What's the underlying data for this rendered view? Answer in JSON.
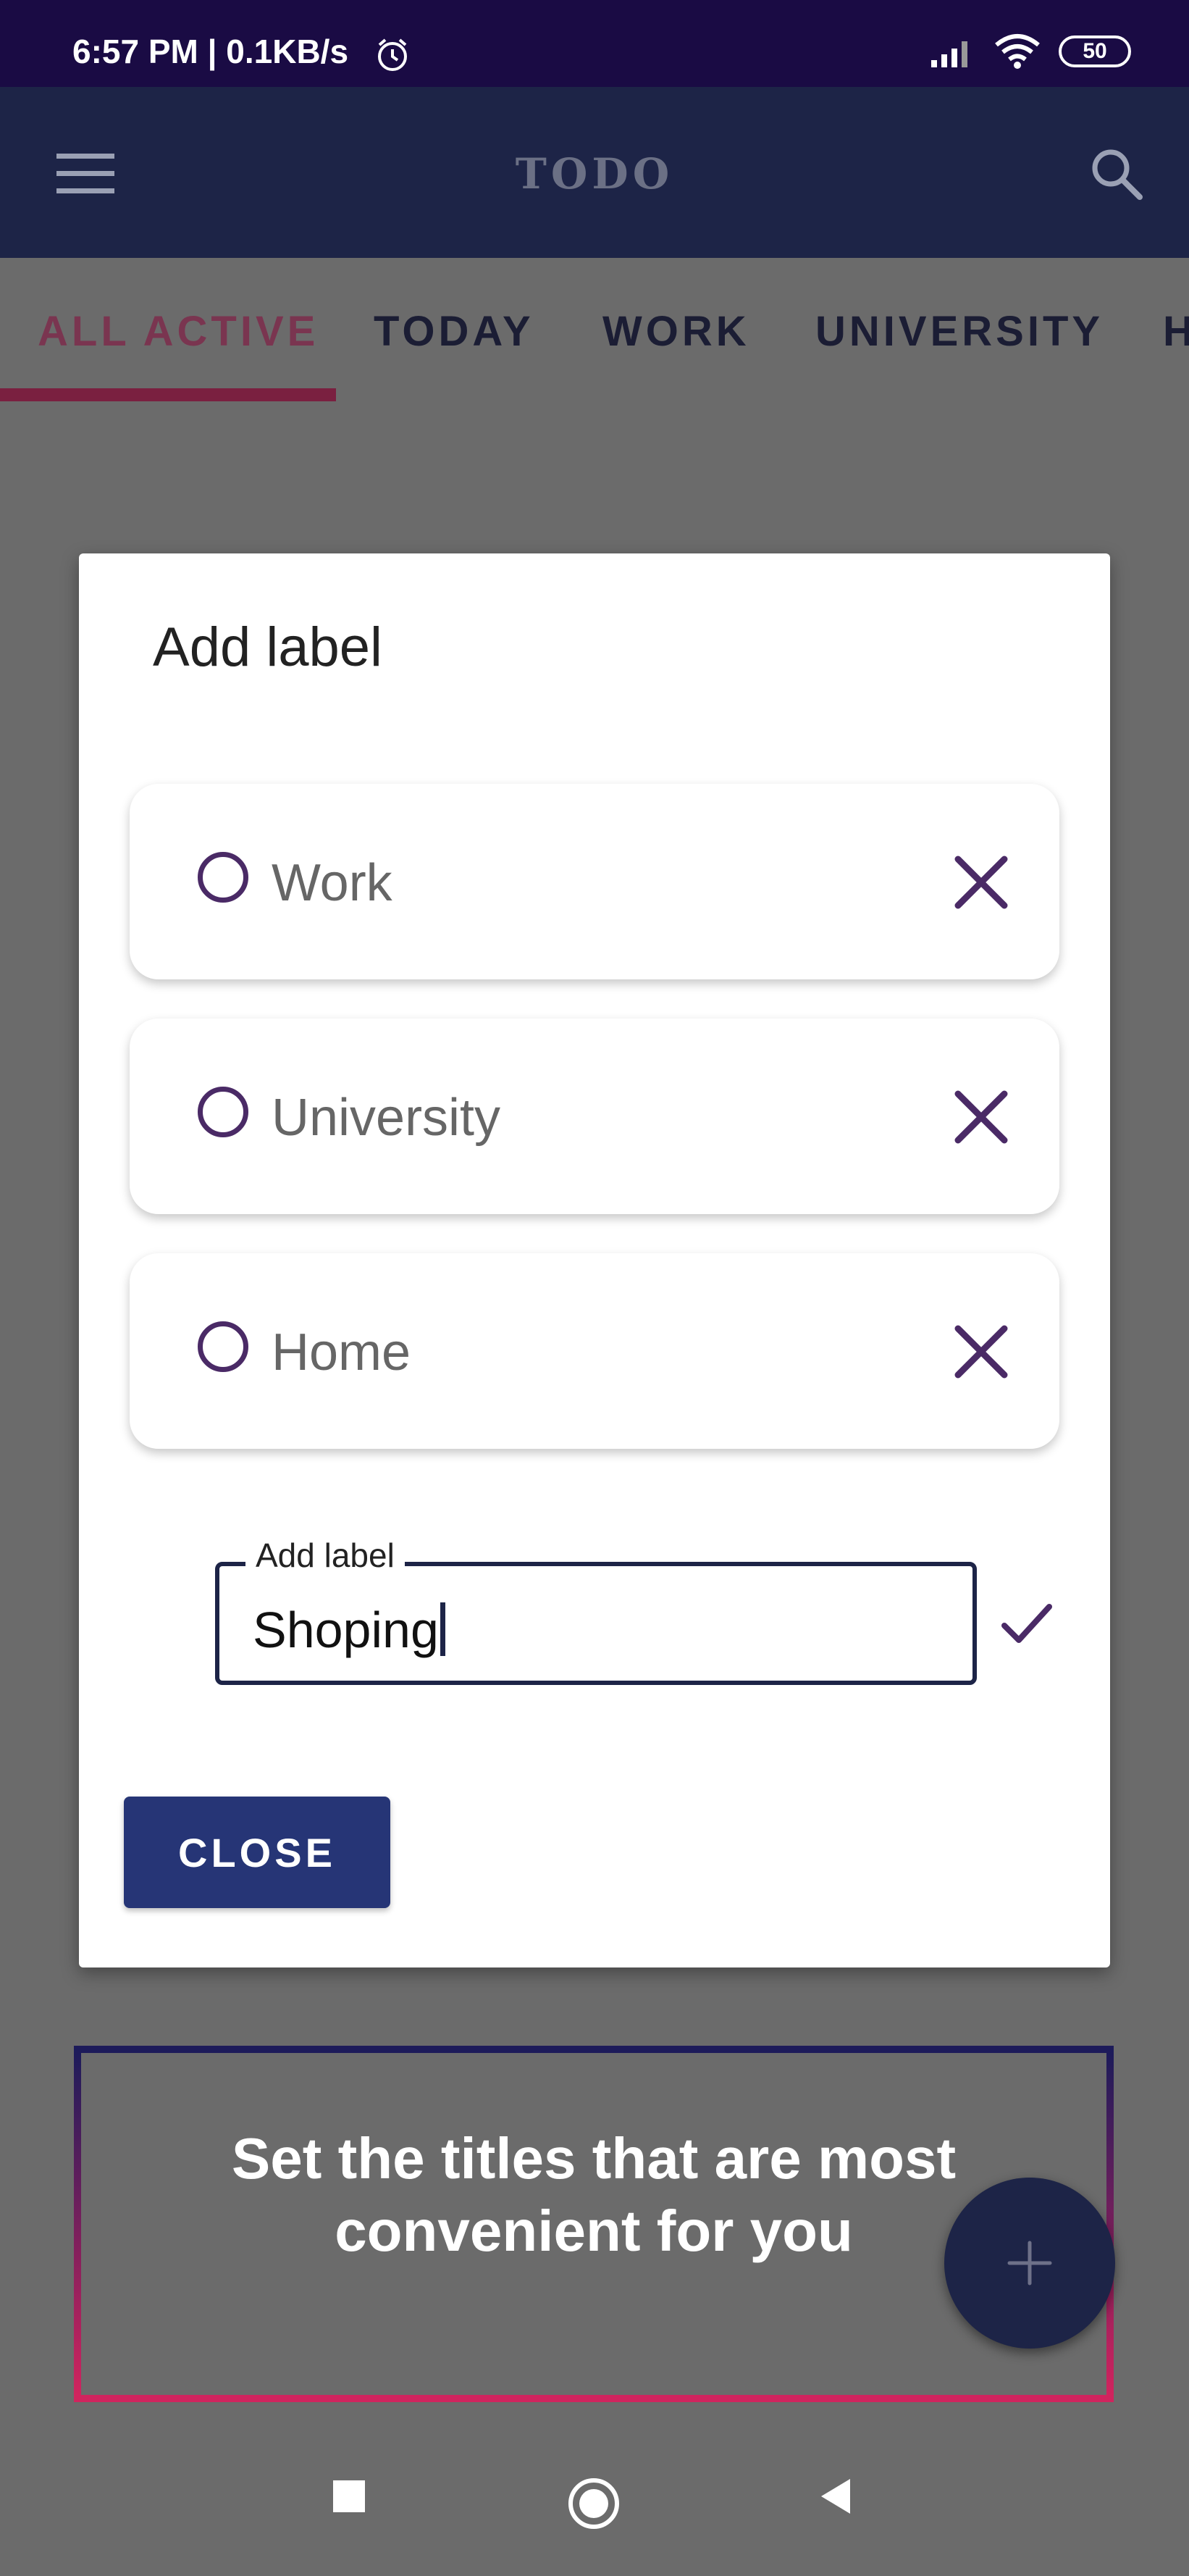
{
  "status_bar": {
    "time": "6:57 PM | 0.1KB/s",
    "battery": "50"
  },
  "app_bar": {
    "title": "TODO"
  },
  "tabs": [
    {
      "label": "ALL ACTIVE",
      "active": true
    },
    {
      "label": "TODAY"
    },
    {
      "label": "WORK"
    },
    {
      "label": "UNIVERSITY"
    },
    {
      "label": "H"
    }
  ],
  "dialog": {
    "title": "Add label",
    "labels": [
      {
        "label": "Work"
      },
      {
        "label": "University"
      },
      {
        "label": "Home"
      }
    ],
    "input": {
      "label": "Add label",
      "value": "Shoping"
    },
    "close_label": "CLOSE"
  },
  "promo": {
    "text_line1": "Set the titles that are most",
    "text_line2": "convenient for you"
  },
  "colors": {
    "accent": "#1d2447",
    "button": "#263576",
    "icon_purple": "#4a2a66",
    "tab_active": "#7a3550"
  }
}
